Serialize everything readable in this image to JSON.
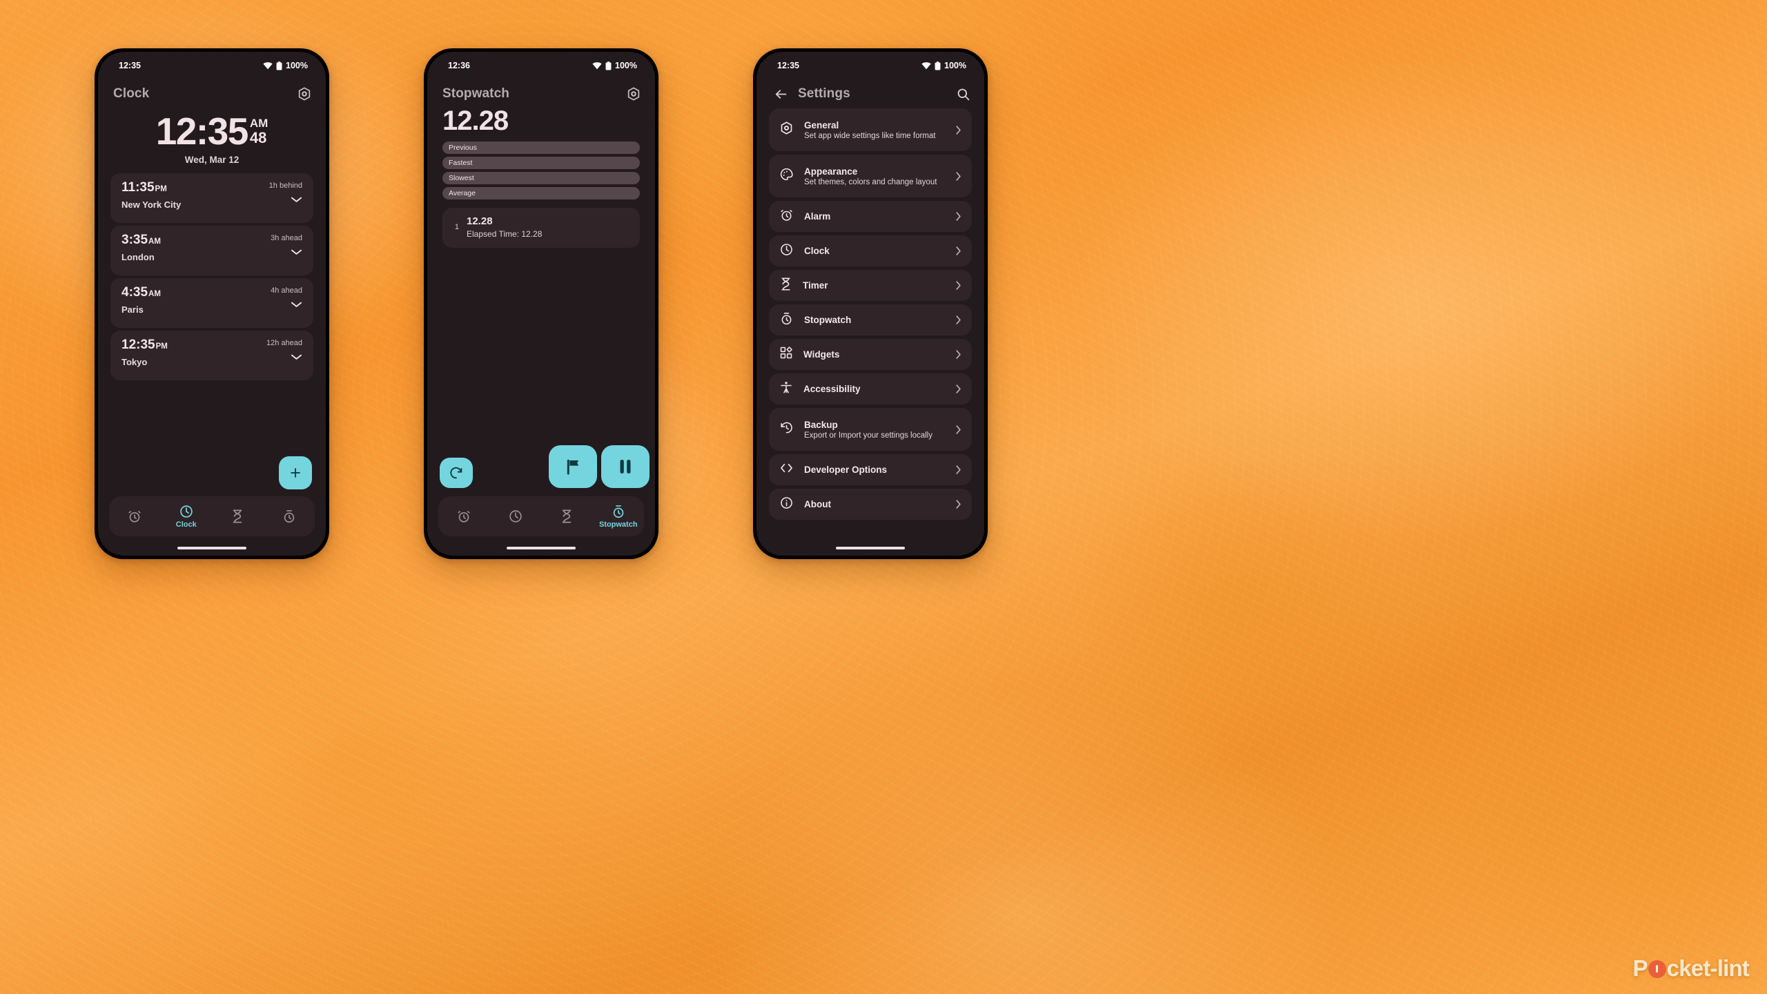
{
  "theme": {
    "accent": "#74d5de",
    "screen_bg": "#231a1d",
    "card_bg": "#312429",
    "stat_bar_bg": "#55474c",
    "text_primary": "#f3e6ea",
    "text_muted": "#b6aaae",
    "backdrop_orange": "#f79430"
  },
  "watermark": {
    "part1": "P",
    "part2": "cket-lint"
  },
  "phones": [
    {
      "id": "clock",
      "statusbar": {
        "time": "12:35",
        "battery": "100%",
        "wifi_icon": "wifi-icon",
        "battery_icon": "battery-icon"
      },
      "appbar": {
        "title": "Clock",
        "action_icon": "settings-gear-icon"
      },
      "hero": {
        "time": "12:35",
        "meridiem": "AM",
        "seconds": "48",
        "date": "Wed, Mar 12"
      },
      "cities": [
        {
          "time": "11:35",
          "meridiem": "PM",
          "name": "New York City",
          "offset": "1h behind",
          "expand_icon": "chevron-down-icon"
        },
        {
          "time": "3:35",
          "meridiem": "AM",
          "name": "London",
          "offset": "3h ahead",
          "expand_icon": "chevron-down-icon"
        },
        {
          "time": "4:35",
          "meridiem": "AM",
          "name": "Paris",
          "offset": "4h ahead",
          "expand_icon": "chevron-down-icon"
        },
        {
          "time": "12:35",
          "meridiem": "PM",
          "name": "Tokyo",
          "offset": "12h ahead",
          "expand_icon": "chevron-down-icon"
        }
      ],
      "fab": {
        "icon": "plus-icon",
        "label": "+"
      },
      "nav": [
        {
          "icon": "alarm-icon",
          "label": "",
          "active": false
        },
        {
          "icon": "clock-icon",
          "label": "Clock",
          "active": true
        },
        {
          "icon": "hourglass-icon",
          "label": "",
          "active": false
        },
        {
          "icon": "stopwatch-icon",
          "label": "",
          "active": false
        }
      ]
    },
    {
      "id": "stopwatch",
      "statusbar": {
        "time": "12:36",
        "battery": "100%",
        "wifi_icon": "wifi-icon",
        "battery_icon": "battery-icon"
      },
      "appbar": {
        "title": "Stopwatch",
        "action_icon": "settings-gear-icon"
      },
      "elapsed": "12.28",
      "stats": [
        {
          "label": "Previous"
        },
        {
          "label": "Fastest"
        },
        {
          "label": "Slowest"
        },
        {
          "label": "Average"
        }
      ],
      "laps": [
        {
          "index": "1",
          "time": "12.28",
          "elapsed": "Elapsed Time: 12.28"
        }
      ],
      "controls": [
        {
          "name": "reset-button",
          "icon": "refresh-icon"
        },
        {
          "name": "lap-button",
          "icon": "flag-icon"
        },
        {
          "name": "pause-button",
          "icon": "pause-icon"
        }
      ],
      "nav": [
        {
          "icon": "alarm-icon",
          "label": "",
          "active": false
        },
        {
          "icon": "clock-icon",
          "label": "",
          "active": false
        },
        {
          "icon": "hourglass-icon",
          "label": "",
          "active": false
        },
        {
          "icon": "stopwatch-icon",
          "label": "Stopwatch",
          "active": true
        }
      ]
    },
    {
      "id": "settings",
      "statusbar": {
        "time": "12:35",
        "battery": "100%",
        "wifi_icon": "wifi-icon",
        "battery_icon": "battery-icon"
      },
      "appbar": {
        "title": "Settings",
        "back_icon": "arrow-left-icon",
        "action_icon": "search-icon"
      },
      "items": [
        {
          "icon": "hexagon-gear-icon",
          "title": "General",
          "sub": "Set app wide settings like time format"
        },
        {
          "icon": "palette-icon",
          "title": "Appearance",
          "sub": "Set themes, colors and change layout"
        },
        {
          "icon": "alarm-icon",
          "title": "Alarm",
          "sub": ""
        },
        {
          "icon": "clock-icon",
          "title": "Clock",
          "sub": ""
        },
        {
          "icon": "hourglass-icon",
          "title": "Timer",
          "sub": ""
        },
        {
          "icon": "stopwatch-icon",
          "title": "Stopwatch",
          "sub": ""
        },
        {
          "icon": "widgets-icon",
          "title": "Widgets",
          "sub": ""
        },
        {
          "icon": "accessibility-icon",
          "title": "Accessibility",
          "sub": ""
        },
        {
          "icon": "backup-restore-icon",
          "title": "Backup",
          "sub": "Export or Import your settings locally"
        },
        {
          "icon": "code-brackets-icon",
          "title": "Developer Options",
          "sub": ""
        },
        {
          "icon": "info-icon",
          "title": "About",
          "sub": ""
        }
      ]
    }
  ]
}
